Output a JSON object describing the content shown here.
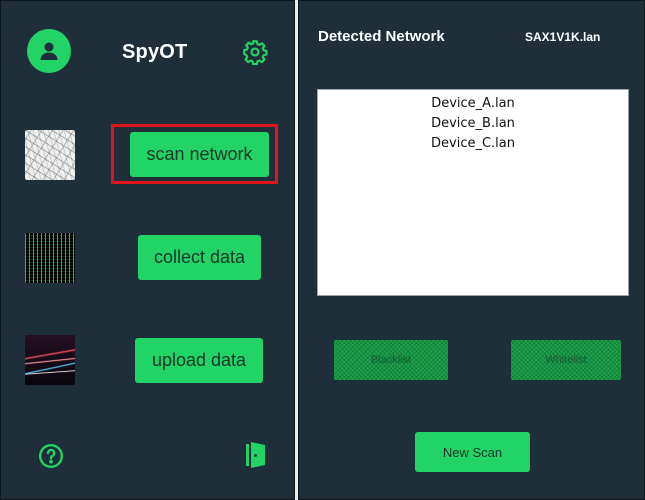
{
  "app": {
    "title": "SpyOT"
  },
  "sidebar": {
    "profile_icon": "user-avatar-icon",
    "settings_icon": "gear-icon",
    "actions": [
      {
        "label": "scan network",
        "thumbnail": "network-map-thumbnail",
        "highlighted": true
      },
      {
        "label": "collect data",
        "thumbnail": "matrix-code-thumbnail",
        "highlighted": false
      },
      {
        "label": "upload data",
        "thumbnail": "light-trails-thumbnail",
        "highlighted": false
      }
    ],
    "help_icon": "question-circle-icon",
    "exit_icon": "door-exit-icon"
  },
  "network": {
    "title": "Detected Network",
    "host": "SAX1V1K.lan",
    "devices": [
      "Device_A.lan",
      "Device_B.lan",
      "Device_C.lan"
    ],
    "blacklist_label": "Blacklist",
    "whitelist_label": "Whitelist",
    "new_scan_label": "New Scan"
  },
  "colors": {
    "accent": "#22d365",
    "panel_bg": "#1f2f3a",
    "highlight": "#e0141c"
  }
}
